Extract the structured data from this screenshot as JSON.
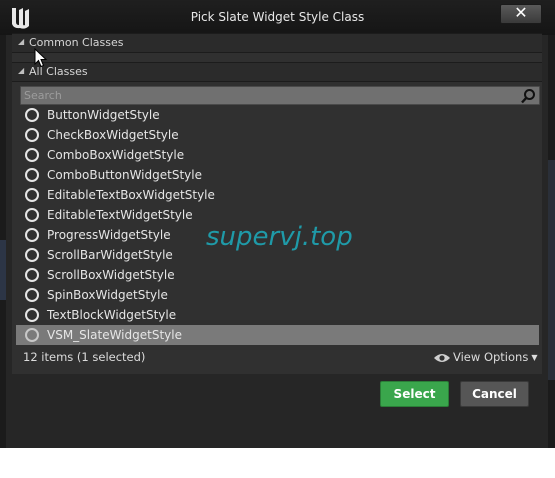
{
  "window": {
    "title": "Pick Slate Widget Style Class",
    "close_label": "✕"
  },
  "sections": {
    "common": {
      "label": "Common Classes"
    },
    "all": {
      "label": "All Classes"
    }
  },
  "search": {
    "placeholder": "Search",
    "value": ""
  },
  "items": [
    {
      "label": "ButtonWidgetStyle"
    },
    {
      "label": "CheckBoxWidgetStyle"
    },
    {
      "label": "ComboBoxWidgetStyle"
    },
    {
      "label": "ComboButtonWidgetStyle"
    },
    {
      "label": "EditableTextBoxWidgetStyle"
    },
    {
      "label": "EditableTextWidgetStyle"
    },
    {
      "label": "ProgressWidgetStyle"
    },
    {
      "label": "ScrollBarWidgetStyle"
    },
    {
      "label": "ScrollBoxWidgetStyle"
    },
    {
      "label": "SpinBoxWidgetStyle"
    },
    {
      "label": "TextBlockWidgetStyle"
    },
    {
      "label": "VSM_SlateWidgetStyle"
    }
  ],
  "selected_item": "VSM_SlateWidgetStyle",
  "status": {
    "text": "12 items (1 selected)"
  },
  "view_options": {
    "label": "View Options"
  },
  "buttons": {
    "select_label": "Select",
    "cancel_label": "Cancel"
  },
  "watermark": {
    "text": "supervj.top"
  },
  "colors": {
    "select_green": "#3aa64c",
    "selected_row": "#7a7a7a",
    "watermark": "#1f9aa8"
  }
}
